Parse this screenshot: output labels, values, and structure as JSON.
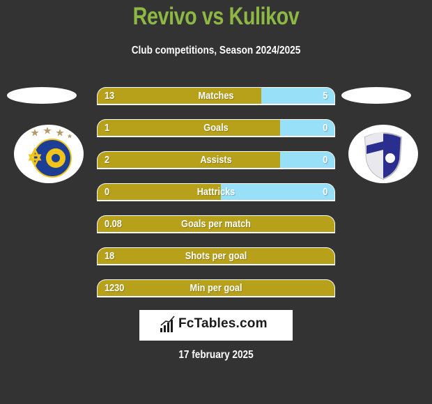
{
  "header": {
    "title": "Revivo vs Kulikov",
    "subtitle": "Club competitions, Season 2024/2025"
  },
  "teams": {
    "left": {
      "logo_icon": "maccabi-tel-aviv-crest-icon"
    },
    "right": {
      "logo_icon": "hapoel-kfar-saba-crest-icon"
    }
  },
  "colors": {
    "title": "#8db843",
    "left_bar": "#b8a11a",
    "right_bar": "#98e0f8",
    "background": "#333333"
  },
  "stats": [
    {
      "label": "Matches",
      "left": "13",
      "right": "5",
      "left_share": 0.69
    },
    {
      "label": "Goals",
      "left": "1",
      "right": "0",
      "left_share": 0.77
    },
    {
      "label": "Assists",
      "left": "2",
      "right": "0",
      "left_share": 0.77
    },
    {
      "label": "Hattricks",
      "left": "0",
      "right": "0",
      "left_share": 0.52
    },
    {
      "label": "Goals per match",
      "left": "0.08",
      "right": "",
      "left_share": 1
    },
    {
      "label": "Shots per goal",
      "left": "18",
      "right": "",
      "left_share": 1
    },
    {
      "label": "Min per goal",
      "left": "1230",
      "right": "",
      "left_share": 1
    }
  ],
  "brand": {
    "name": "FcTables.com",
    "icon": "bar-chart-icon"
  },
  "footer": {
    "date": "17 february 2025"
  }
}
